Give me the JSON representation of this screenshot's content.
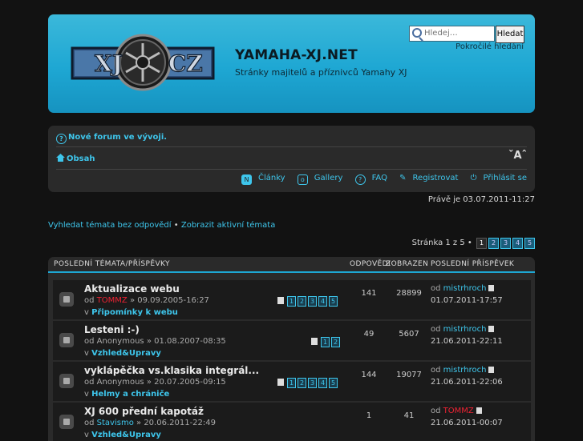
{
  "header": {
    "title": "YAMAHA-XJ.NET",
    "description": "Stránky majitelů a příznivců Yamahy XJ",
    "logo_left": "XJ",
    "logo_right": "CZ",
    "search_placeholder": "Hledej…",
    "search_button": "Hledat",
    "advanced_search": "Pokročilé hledání"
  },
  "navbar": {
    "notice": "Nové forum ve vývoji.",
    "home": "Obsah",
    "font_control": "ˇAˆ",
    "links": {
      "articles": "Články",
      "gallery": "Gallery",
      "faq": "FAQ",
      "register": "Registrovat",
      "login": "Přihlásit se"
    }
  },
  "datetime": "Právě je 03.07.2011-11:27",
  "quicklinks": {
    "unanswered": "Vyhledat témata bez odpovědí",
    "separator": "•",
    "active": "Zobrazit aktivní témata"
  },
  "pagination": {
    "label": "Stránka 1 z 5",
    "separator": "•",
    "pages": [
      "1",
      "2",
      "3",
      "4",
      "5"
    ],
    "current": "1"
  },
  "table": {
    "col_topics": "POSLEDNÍ TÉMATA/PŘÍSPĚVKY",
    "col_replies": "ODPOVĚDI",
    "col_views": "ZOBRAZEN",
    "col_last": "POSLEDNÍ PŘÍSPĚVEK",
    "rows": [
      {
        "title": "Aktualizace webu",
        "by_prefix": "od",
        "author": "TOMMZ",
        "date": "» 09.09.2005-16:27",
        "forum_prefix": "v",
        "forum": "Připomínky k webu",
        "pages": [
          "1",
          "2",
          "3",
          "4",
          "5"
        ],
        "replies": "141",
        "views": "28899",
        "last_prefix": "od",
        "last_author": "mistrhroch",
        "last_date": "01.07.2011-17:57"
      },
      {
        "title": "Lesteni :-)",
        "by_prefix": "od",
        "author": "Anonymous",
        "date": "» 01.08.2007-08:35",
        "forum_prefix": "v",
        "forum": "Vzhled&Upravy",
        "pages": [
          "1",
          "2"
        ],
        "replies": "49",
        "views": "5607",
        "last_prefix": "od",
        "last_author": "mistrhroch",
        "last_date": "21.06.2011-22:11"
      },
      {
        "title": "vyklápěčka vs.klasika integrál...",
        "by_prefix": "od",
        "author": "Anonymous",
        "date": "» 20.07.2005-09:15",
        "forum_prefix": "v",
        "forum": "Helmy a chrániče",
        "pages": [
          "1",
          "2",
          "3",
          "4",
          "5"
        ],
        "replies": "144",
        "views": "19077",
        "last_prefix": "od",
        "last_author": "mistrhroch",
        "last_date": "21.06.2011-22:06"
      },
      {
        "title": "XJ 600 přední kapotáž",
        "by_prefix": "od",
        "author": "Stavismo",
        "date": "» 20.06.2011-22:49",
        "forum_prefix": "v",
        "forum": "Vzhled&Upravy",
        "pages": [],
        "replies": "1",
        "views": "41",
        "last_prefix": "od",
        "last_author": "TOMMZ",
        "last_date": "21.06.2011-00:07"
      }
    ]
  },
  "colors": {
    "accent": "#3ec6ec",
    "header_bg": "#1ea7d3",
    "moderator": "#e23"
  }
}
